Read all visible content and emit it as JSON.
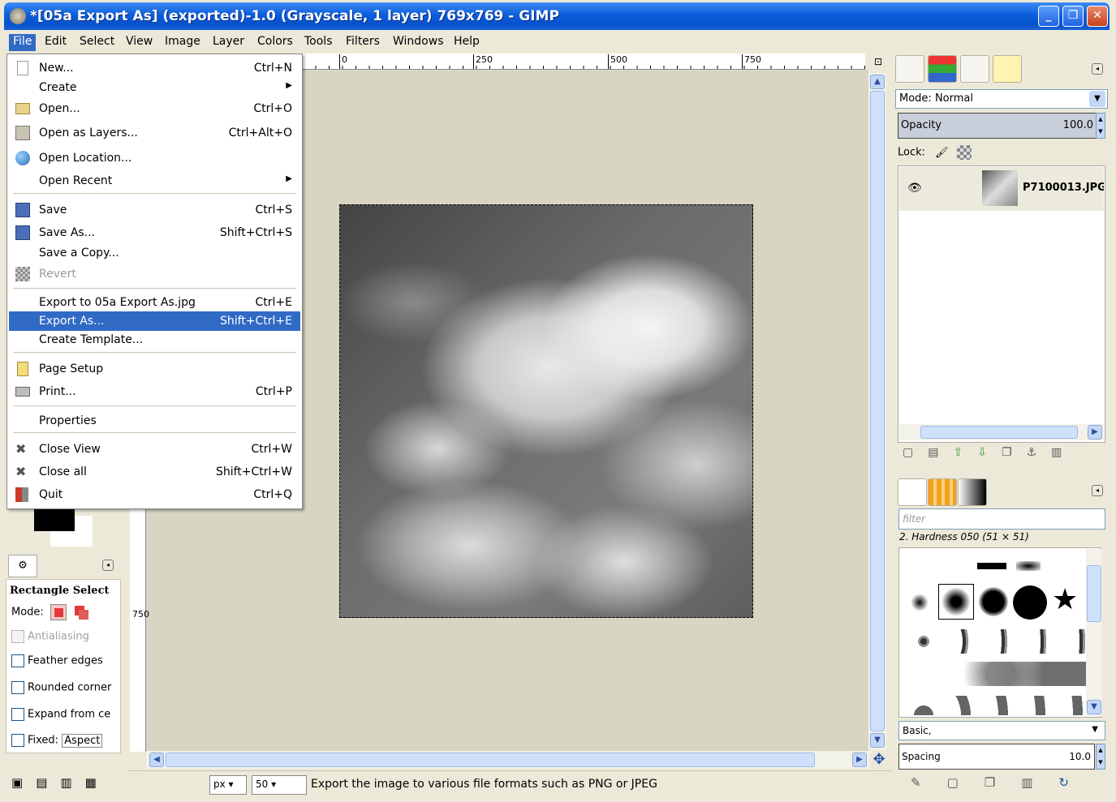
{
  "window": {
    "title": "*[05a Export As] (exported)-1.0 (Grayscale, 1 layer) 769x769 - GIMP"
  },
  "menubar": {
    "items": [
      {
        "label": "File"
      },
      {
        "label": "Edit"
      },
      {
        "label": "Select"
      },
      {
        "label": "View"
      },
      {
        "label": "Image"
      },
      {
        "label": "Layer"
      },
      {
        "label": "Colors"
      },
      {
        "label": "Tools"
      },
      {
        "label": "Filters"
      },
      {
        "label": "Windows"
      },
      {
        "label": "Help"
      }
    ]
  },
  "file_menu": {
    "items": [
      {
        "label": "New...",
        "shortcut": "Ctrl+N"
      },
      {
        "label": "Create",
        "shortcut": ""
      },
      {
        "label": "Open...",
        "shortcut": "Ctrl+O"
      },
      {
        "label": "Open as Layers...",
        "shortcut": "Ctrl+Alt+O"
      },
      {
        "label": "Open Location...",
        "shortcut": ""
      },
      {
        "label": "Open Recent",
        "shortcut": ""
      },
      {
        "label": "Save",
        "shortcut": "Ctrl+S"
      },
      {
        "label": "Save As...",
        "shortcut": "Shift+Ctrl+S"
      },
      {
        "label": "Save a Copy...",
        "shortcut": ""
      },
      {
        "label": "Revert",
        "shortcut": ""
      },
      {
        "label": "Export to 05a Export As.jpg",
        "shortcut": "Ctrl+E"
      },
      {
        "label": "Export As...",
        "shortcut": "Shift+Ctrl+E"
      },
      {
        "label": "Create Template...",
        "shortcut": ""
      },
      {
        "label": "Page Setup",
        "shortcut": ""
      },
      {
        "label": "Print...",
        "shortcut": "Ctrl+P"
      },
      {
        "label": "Properties",
        "shortcut": ""
      },
      {
        "label": "Close View",
        "shortcut": "Ctrl+W"
      },
      {
        "label": "Close all",
        "shortcut": "Shift+Ctrl+W"
      },
      {
        "label": "Quit",
        "shortcut": "Ctrl+Q"
      }
    ],
    "highlighted": "Export As..."
  },
  "ruler": {
    "h_marks": [
      "0",
      "250",
      "500",
      "750"
    ],
    "v_mark": "750"
  },
  "tool_options": {
    "title": "Rectangle Select",
    "mode_label": "Mode:",
    "antialiasing": "Antialiasing",
    "feather": "Feather edges",
    "rounded": "Rounded corner",
    "expand": "Expand from ce",
    "fixed": "Fixed:",
    "fixed_value": "Aspect"
  },
  "status": {
    "unit": "px",
    "zoom": "50",
    "message": "Export the image to various file formats such as PNG or JPEG"
  },
  "layers": {
    "mode_label": "Mode:",
    "mode_value": "Normal",
    "opacity_label": "Opacity",
    "opacity_value": "100.0",
    "lock_label": "Lock:",
    "layer_name": "P7100013.JPG"
  },
  "brushes": {
    "filter_placeholder": "filter",
    "current_brush": "2. Hardness 050 (51 × 51)",
    "tag": "Basic,",
    "spacing_label": "Spacing",
    "spacing_value": "10.0"
  }
}
